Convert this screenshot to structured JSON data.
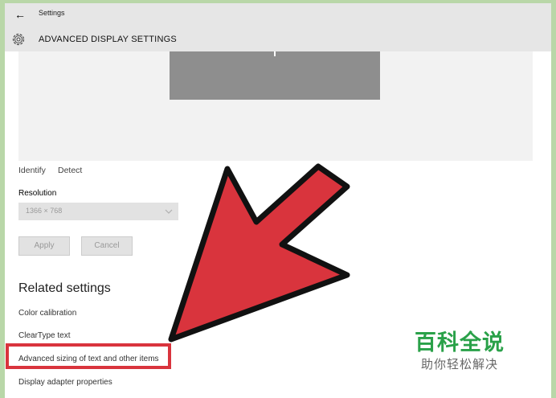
{
  "titlebar": {
    "back_icon": "back-arrow-icon",
    "title": "Settings"
  },
  "header": {
    "icon": "gear-icon",
    "title": "ADVANCED DISPLAY SETTINGS"
  },
  "display": {
    "identify_label": "Identify",
    "detect_label": "Detect"
  },
  "resolution": {
    "label": "Resolution",
    "value": "1366 × 768",
    "icon": "chevron-down-icon"
  },
  "buttons": {
    "apply": "Apply",
    "cancel": "Cancel"
  },
  "related": {
    "heading": "Related settings",
    "links": [
      "Color calibration",
      "ClearType text",
      "Advanced sizing of text and other items",
      "Display adapter properties"
    ]
  },
  "annotation": {
    "arrow_color": "#d9343d",
    "highlight_color": "#d9343d"
  },
  "watermark": {
    "title": "百科全说",
    "subtitle": "助你轻松解决"
  }
}
